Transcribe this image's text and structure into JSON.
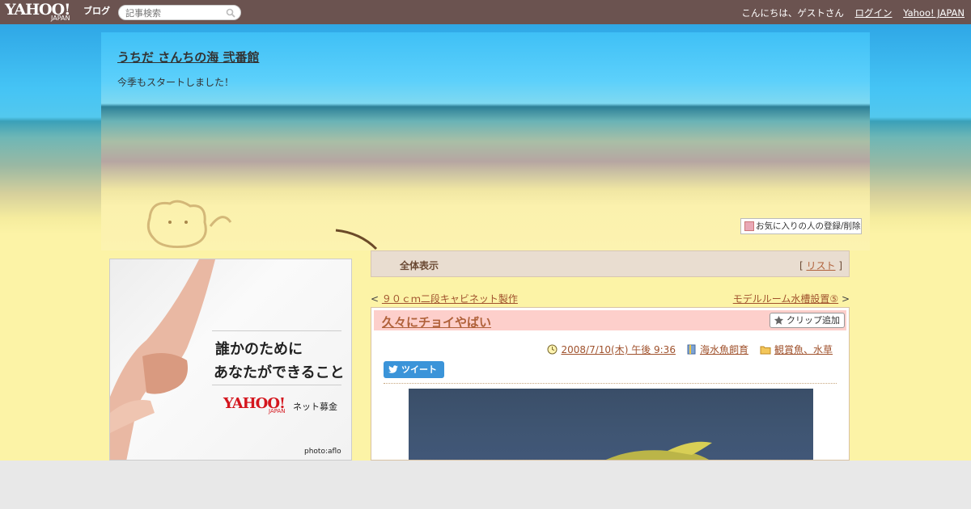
{
  "topbar": {
    "logo_text": "YAHOO!",
    "logo_sub": "JAPAN",
    "blog_label": "ブログ",
    "search_placeholder": "記事検索",
    "greeting": "こんにちは、ゲストさん",
    "login": "ログイン",
    "yahoo_japan": "Yahoo! JAPAN"
  },
  "blog": {
    "title": "うちだ さんちの海 弐番館",
    "description": "今季もスタートしました！",
    "fav_button": "お気に入りの人の登録/削除"
  },
  "ad": {
    "line1": "誰かのために",
    "line2": "あなたができること",
    "logo_text": "YAHOO!",
    "logo_sub": "JAPAN",
    "tagline": "ネット募金",
    "credit": "photo:aflo"
  },
  "nav": {
    "all_display": "全体表示",
    "list_open": "[",
    "list_label": "リスト",
    "list_close": "]",
    "prev_mark": "<",
    "prev_title": "９０ｃｍ二段キャビネット製作",
    "next_title": "モデルルーム水槽設置⑤",
    "next_mark": ">"
  },
  "article": {
    "title": "久々にチョイやばい",
    "clip_button": "クリップ追加",
    "date": "2008/7/10(木) 午後 9:36",
    "category": "海水魚飼育",
    "folder": "観賞魚、水草",
    "tweet_button": "ツイート"
  },
  "colors": {
    "topbar": "#6b5350",
    "link": "#a0522d",
    "title_bg": "#fdcfcb",
    "tweet": "#3b94d9",
    "sand": "#fcf3a6"
  }
}
